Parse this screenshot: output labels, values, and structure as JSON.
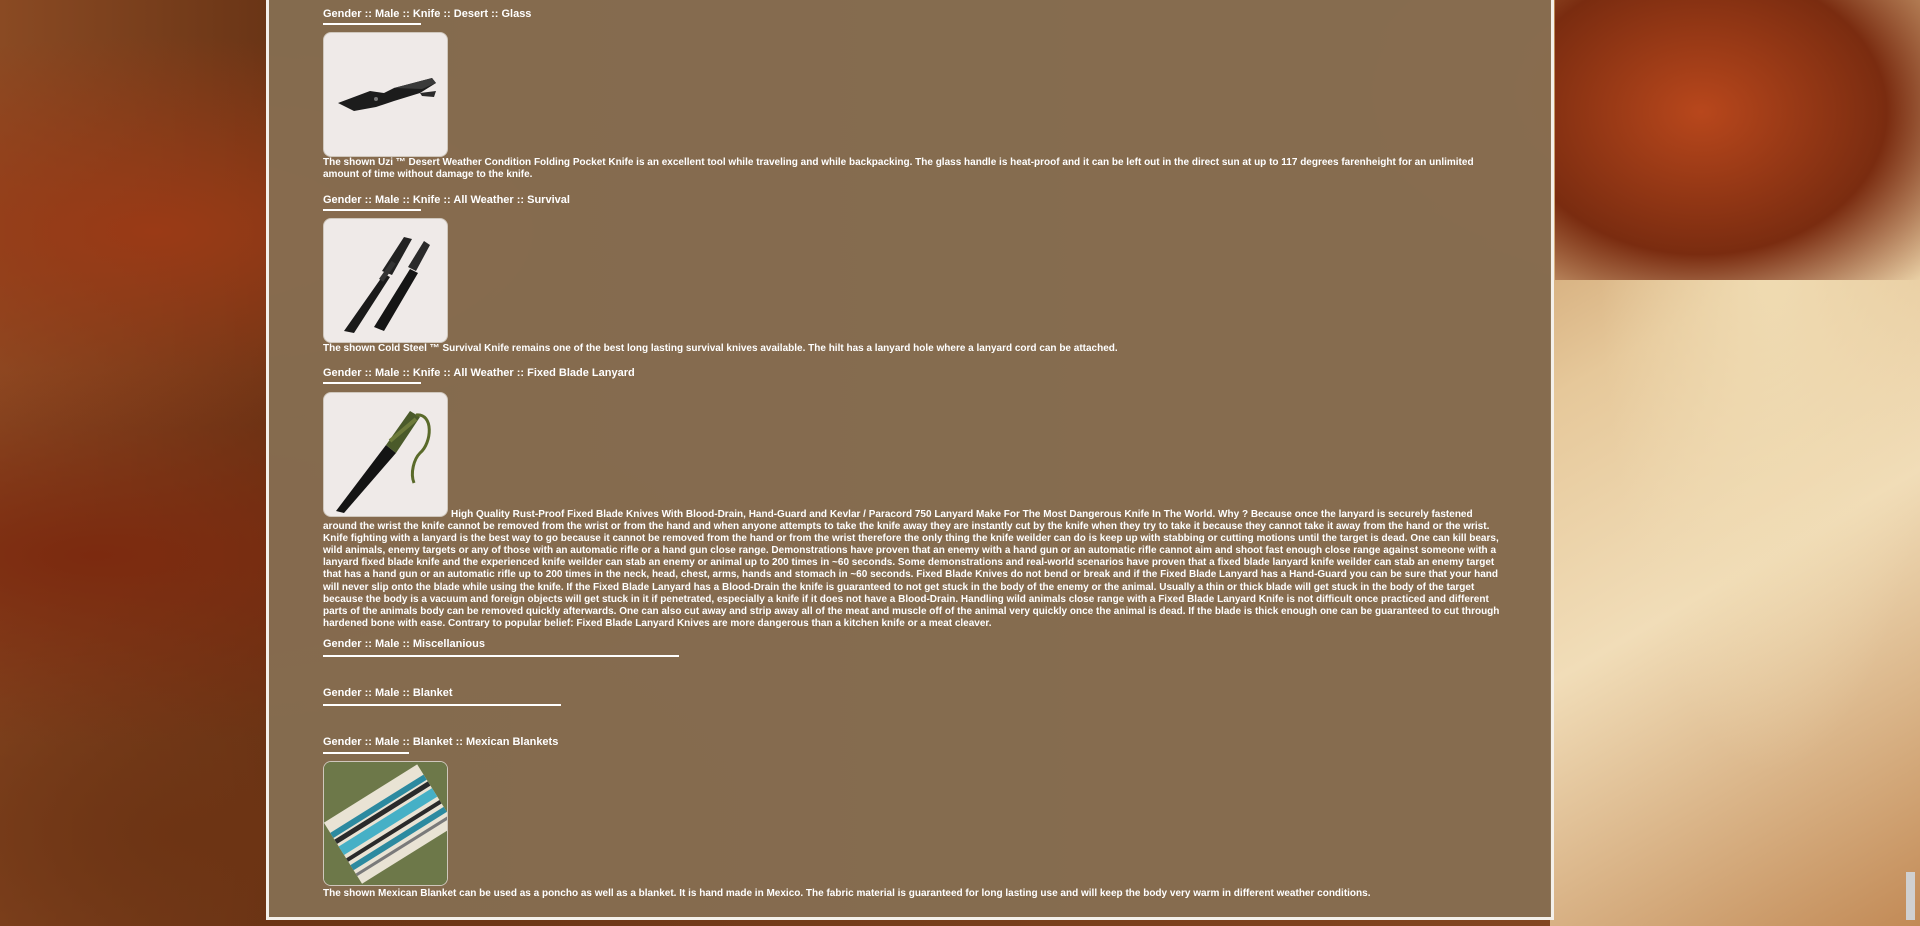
{
  "sections": [
    {
      "heading": "Gender :: Male :: Knife :: Desert :: Glass",
      "image": "folding-pocket-knife-image",
      "description": "The shown Uzi ™ Desert Weather Condition Folding Pocket Knife is an excellent tool while traveling and while backpacking. The glass handle is heat-proof and it can be left out in the direct sun at up to 117 degrees farenheight for an unlimited amount of time without damage to the knife."
    },
    {
      "heading": "Gender :: Male :: Knife :: All Weather :: Survival",
      "image": "survival-knife-image",
      "description": "The shown Cold Steel ™ Survival Knife remains one of the best long lasting survival knives available. The hilt has a lanyard hole where a lanyard cord can be attached."
    },
    {
      "heading": "Gender :: Male :: Knife :: All Weather :: Fixed Blade Lanyard",
      "image": "fixed-blade-lanyard-knife-image",
      "description": "High Quality Rust-Proof Fixed Blade Knives With Blood-Drain, Hand-Guard and Kevlar / Paracord 750 Lanyard Make For The Most Dangerous Knife In The World. Why ? Because once the lanyard is securely fastened around the wrist the knife cannot be removed from the wrist or from the hand and when anyone attempts to take the knife away they are instantly cut by the knife when they try to take it because they cannot take it away from the hand or the wrist. Knife fighting with a lanyard is the best way to go because it cannot be removed from the hand or from the wrist therefore the only thing the knife weilder can do is keep up with stabbing or cutting motions until the target is dead. One can kill bears, wild animals, enemy targets or any of those with an automatic rifle or a hand gun close range. Demonstrations have proven that an enemy with a hand gun or an automatic rifle cannot aim and shoot fast enough close range against someone with a lanyard fixed blade knife and the experienced knife weilder can stab an enemy or animal up to 200 times in ~60 seconds. Some demonstrations and real-world scenarios have proven that a fixed blade lanyard knife weilder can stab an enemy target that has a hand gun or an automatic rifle up to 200 times in the neck, head, chest, arms, hands and stomach in ~60 seconds. Fixed Blade Knives do not bend or break and if the Fixed Blade Lanyard has a Hand-Guard you can be sure that your hand will never slip onto the blade while using the knife. If the Fixed Blade Lanyard has a Blood-Drain the knife is guaranteed to not get stuck in the body of the enemy or the animal. Usually a thin or thick blade will get stuck in the body of the target because the body is a vacuum and foreign objects will get stuck in it if penetrated, especially a knife if it does not have a Blood-Drain. Handling wild animals close range with a Fixed Blade Lanyard Knife is not difficult once practiced and different parts of the animals body can be removed quickly afterwards. One can also cut away and strip away all of the meat and muscle off of the animal very quickly once the animal is dead. If the blade is thick enough one can be guaranteed to cut through hardened bone with ease. Contrary to popular belief: Fixed Blade Lanyard Knives are more dangerous than a kitchen knife or a meat cleaver."
    },
    {
      "heading": "Gender :: Male :: Miscellanious"
    },
    {
      "heading": "Gender :: Male :: Blanket"
    },
    {
      "heading": "Gender :: Male :: Blanket :: Mexican Blankets",
      "image": "mexican-blanket-image",
      "description": "The shown Mexican Blanket can be used as a poncho as well as a blanket. It is hand made in Mexico. The fabric material is guaranteed for long lasting use and will keep the body very warm in different weather conditions."
    }
  ]
}
